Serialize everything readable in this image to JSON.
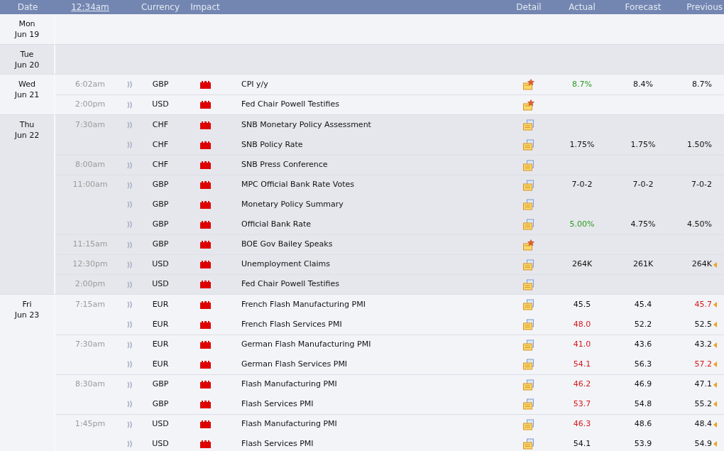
{
  "header": {
    "date": "Date",
    "time_link": "12:34am",
    "currency": "Currency",
    "impact": "Impact",
    "detail": "Detail",
    "actual": "Actual",
    "forecast": "Forecast",
    "previous": "Previous"
  },
  "days": [
    {
      "weekday": "Mon",
      "date": "Jun 19"
    },
    {
      "weekday": "Tue",
      "date": "Jun 20"
    },
    {
      "weekday": "Wed",
      "date": "Jun 21",
      "events": [
        {
          "time": "6:02am",
          "currency": "GBP",
          "color": "#dd0000",
          "title": "CPI y/y",
          "starred": true,
          "actual": {
            "text": "8.7%",
            "color": "#2a9a1e"
          },
          "forecast": "8.4%",
          "previous": {
            "text": "8.7%",
            "color": "#111111",
            "revised": false
          }
        },
        {
          "time": "2:00pm",
          "currency": "USD",
          "color": "#dd0000",
          "title": "Fed Chair Powell Testifies",
          "starred": true
        }
      ]
    },
    {
      "weekday": "Thu",
      "date": "Jun 22",
      "events": [
        {
          "time": "7:30am",
          "currency": "CHF",
          "color": "#dd0000",
          "title": "SNB Monetary Policy Assessment",
          "starred": false
        },
        {
          "currency": "CHF",
          "color": "#dd0000",
          "title": "SNB Policy Rate",
          "starred": false,
          "actual": {
            "text": "1.75%",
            "color": "#111111"
          },
          "forecast": "1.75%",
          "previous": {
            "text": "1.50%",
            "color": "#111111",
            "revised": false
          }
        },
        {
          "time": "8:00am",
          "currency": "CHF",
          "color": "#dd0000",
          "title": "SNB Press Conference",
          "starred": false
        },
        {
          "time": "11:00am",
          "currency": "GBP",
          "color": "#dd0000",
          "title": "MPC Official Bank Rate Votes",
          "starred": false,
          "actual": {
            "text": "7-0-2",
            "color": "#111111"
          },
          "forecast": "7-0-2",
          "previous": {
            "text": "7-0-2",
            "color": "#111111",
            "revised": false
          }
        },
        {
          "currency": "GBP",
          "color": "#dd0000",
          "title": "Monetary Policy Summary",
          "starred": false
        },
        {
          "currency": "GBP",
          "color": "#dd0000",
          "title": "Official Bank Rate",
          "starred": false,
          "actual": {
            "text": "5.00%",
            "color": "#2a9a1e"
          },
          "forecast": "4.75%",
          "previous": {
            "text": "4.50%",
            "color": "#111111",
            "revised": false
          }
        },
        {
          "time": "11:15am",
          "currency": "GBP",
          "color": "#dd0000",
          "title": "BOE Gov Bailey Speaks",
          "starred": true
        },
        {
          "time": "12:30pm",
          "currency": "USD",
          "color": "#dd0000",
          "title": "Unemployment Claims",
          "starred": false,
          "actual": {
            "text": "264K",
            "color": "#111111"
          },
          "forecast": "261K",
          "previous": {
            "text": "264K",
            "color": "#111111",
            "revised": true
          }
        },
        {
          "time": "2:00pm",
          "currency": "USD",
          "color": "#dd0000",
          "title": "Fed Chair Powell Testifies",
          "starred": false
        }
      ]
    },
    {
      "weekday": "Fri",
      "date": "Jun 23",
      "events": [
        {
          "time": "7:15am",
          "currency": "EUR",
          "color": "#dd0000",
          "title": "French Flash Manufacturing PMI",
          "starred": false,
          "actual": {
            "text": "45.5",
            "color": "#111111"
          },
          "forecast": "45.4",
          "previous": {
            "text": "45.7",
            "color": "#d51a1a",
            "revised": true
          }
        },
        {
          "currency": "EUR",
          "color": "#dd0000",
          "title": "French Flash Services PMI",
          "starred": false,
          "actual": {
            "text": "48.0",
            "color": "#d51a1a"
          },
          "forecast": "52.2",
          "previous": {
            "text": "52.5",
            "color": "#111111",
            "revised": true
          }
        },
        {
          "time": "7:30am",
          "currency": "EUR",
          "color": "#dd0000",
          "title": "German Flash Manufacturing PMI",
          "starred": false,
          "actual": {
            "text": "41.0",
            "color": "#d51a1a"
          },
          "forecast": "43.6",
          "previous": {
            "text": "43.2",
            "color": "#111111",
            "revised": true
          }
        },
        {
          "currency": "EUR",
          "color": "#dd0000",
          "title": "German Flash Services PMI",
          "starred": false,
          "actual": {
            "text": "54.1",
            "color": "#d51a1a"
          },
          "forecast": "56.3",
          "previous": {
            "text": "57.2",
            "color": "#d51a1a",
            "revised": true
          }
        },
        {
          "time": "8:30am",
          "currency": "GBP",
          "color": "#dd0000",
          "title": "Flash Manufacturing PMI",
          "starred": false,
          "actual": {
            "text": "46.2",
            "color": "#d51a1a"
          },
          "forecast": "46.9",
          "previous": {
            "text": "47.1",
            "color": "#111111",
            "revised": true
          }
        },
        {
          "currency": "GBP",
          "color": "#dd0000",
          "title": "Flash Services PMI",
          "starred": false,
          "actual": {
            "text": "53.7",
            "color": "#d51a1a"
          },
          "forecast": "54.8",
          "previous": {
            "text": "55.2",
            "color": "#111111",
            "revised": true
          }
        },
        {
          "time": "1:45pm",
          "currency": "USD",
          "color": "#dd0000",
          "title": "Flash Manufacturing PMI",
          "starred": false,
          "actual": {
            "text": "46.3",
            "color": "#d51a1a"
          },
          "forecast": "48.6",
          "previous": {
            "text": "48.4",
            "color": "#111111",
            "revised": true
          }
        },
        {
          "currency": "USD",
          "color": "#dd0000",
          "title": "Flash Services PMI",
          "starred": false,
          "actual": {
            "text": "54.1",
            "color": "#111111"
          },
          "forecast": "53.9",
          "previous": {
            "text": "54.9",
            "color": "#111111",
            "revised": true
          }
        }
      ]
    }
  ]
}
